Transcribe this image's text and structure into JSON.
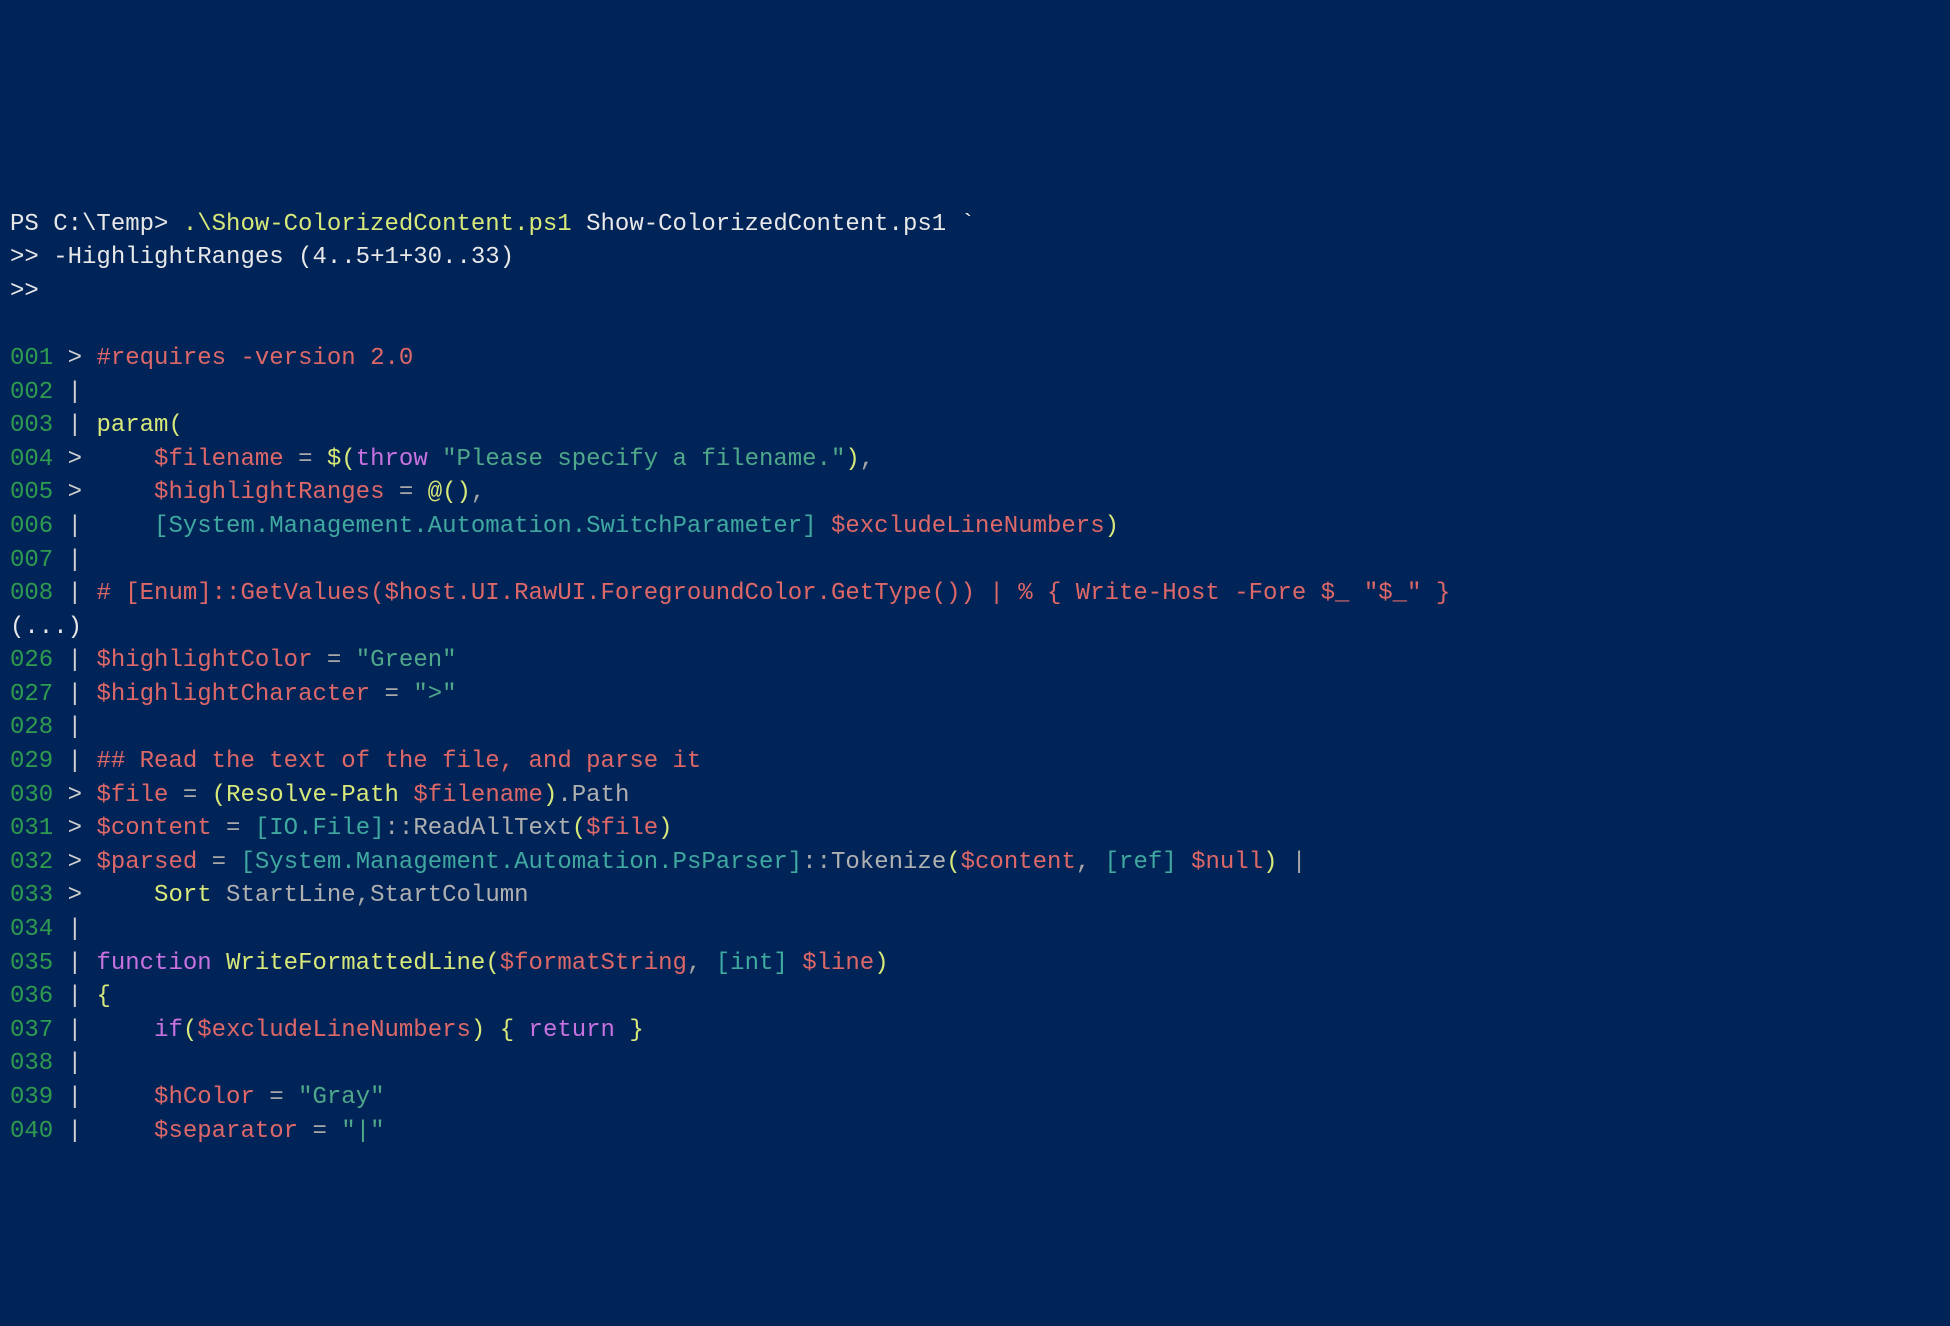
{
  "prompt": {
    "line1_a": "PS C:\\Temp> ",
    "line1_b": ".\\Show-ColorizedContent.ps1",
    "line1_c": " Show-ColorizedContent.ps1 `",
    "line2_a": ">> ",
    "line2_b": "-HighlightRanges (4..5+1+30..33)",
    "line3": ">>"
  },
  "ellipsis": "(...)",
  "code": {
    "l001": {
      "num": "001",
      "gut": " > ",
      "a": "#requires -version 2.0"
    },
    "l002": {
      "num": "002",
      "gut": " | "
    },
    "l003": {
      "num": "003",
      "gut": " | ",
      "a": "param",
      "b": "("
    },
    "l004": {
      "num": "004",
      "gut": " >     ",
      "a": "$filename",
      "b": " = ",
      "c": "$(",
      "d": "throw",
      "e": " \"Please specify a filename.\"",
      "f": ")",
      "g": ","
    },
    "l005": {
      "num": "005",
      "gut": " >     ",
      "a": "$highlightRanges",
      "b": " = ",
      "c": "@()",
      "d": ","
    },
    "l006": {
      "num": "006",
      "gut": " |     ",
      "a": "[System.Management.Automation.SwitchParameter]",
      "b": " ",
      "c": "$excludeLineNumbers",
      "d": ")"
    },
    "l007": {
      "num": "007",
      "gut": " | "
    },
    "l008": {
      "num": "008",
      "gut": " | ",
      "a": "# [Enum]::GetValues($host.UI.RawUI.ForegroundColor.GetType()) | % { Write-Host -Fore $_ \"$_\" }"
    },
    "l026": {
      "num": "026",
      "gut": " | ",
      "a": "$highlightColor",
      "b": " = ",
      "c": "\"Green\""
    },
    "l027": {
      "num": "027",
      "gut": " | ",
      "a": "$highlightCharacter",
      "b": " = ",
      "c": "\">\""
    },
    "l028": {
      "num": "028",
      "gut": " | "
    },
    "l029": {
      "num": "029",
      "gut": " | ",
      "a": "## Read the text of the file, and parse it"
    },
    "l030": {
      "num": "030",
      "gut": " > ",
      "a": "$file",
      "b": " = ",
      "c": "(",
      "d": "Resolve-Path",
      "e": " ",
      "f": "$filename",
      "g": ")",
      "h": ".Path"
    },
    "l031": {
      "num": "031",
      "gut": " > ",
      "a": "$content",
      "b": " = ",
      "c": "[IO.File]",
      "d": "::",
      "e": "ReadAllText",
      "f": "(",
      "g": "$file",
      "h": ")"
    },
    "l032": {
      "num": "032",
      "gut": " > ",
      "a": "$parsed",
      "b": " = ",
      "c": "[System.Management.Automation.PsParser]",
      "d": "::",
      "e": "Tokenize",
      "f": "(",
      "g": "$content",
      "h": ", ",
      "i": "[ref]",
      "j": " ",
      "k": "$null",
      "l": ")",
      "m": " |"
    },
    "l033": {
      "num": "033",
      "gut": " >     ",
      "a": "Sort",
      "b": " StartLine",
      "c": ",",
      "d": "StartColumn"
    },
    "l034": {
      "num": "034",
      "gut": " | "
    },
    "l035": {
      "num": "035",
      "gut": " | ",
      "a": "function",
      "b": " ",
      "c": "WriteFormattedLine",
      "d": "(",
      "e": "$formatString",
      "f": ", ",
      "g": "[int]",
      "h": " ",
      "i": "$line",
      "j": ")"
    },
    "l036": {
      "num": "036",
      "gut": " | ",
      "a": "{"
    },
    "l037": {
      "num": "037",
      "gut": " |     ",
      "a": "if",
      "b": "(",
      "c": "$excludeLineNumbers",
      "d": ")",
      "e": " { ",
      "f": "return",
      "g": " }"
    },
    "l038": {
      "num": "038",
      "gut": " | "
    },
    "l039": {
      "num": "039",
      "gut": " |     ",
      "a": "$hColor",
      "b": " = ",
      "c": "\"Gray\""
    },
    "l040": {
      "num": "040",
      "gut": " |     ",
      "a": "$separator",
      "b": " = ",
      "c": "\"|\""
    }
  }
}
